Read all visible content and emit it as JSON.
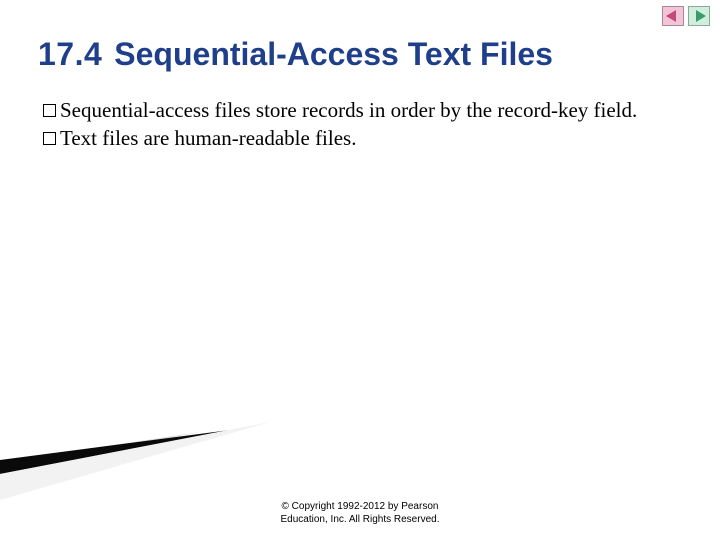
{
  "heading": {
    "number": "17.4",
    "title": "Sequential-Access Text Files"
  },
  "bullets": [
    "Sequential-access files store records in order by the record-key field.",
    "Text files are human-readable files."
  ],
  "footer": {
    "line1": "© Copyright 1992-2012 by Pearson",
    "line2": "Education, Inc. All Rights Reserved."
  }
}
